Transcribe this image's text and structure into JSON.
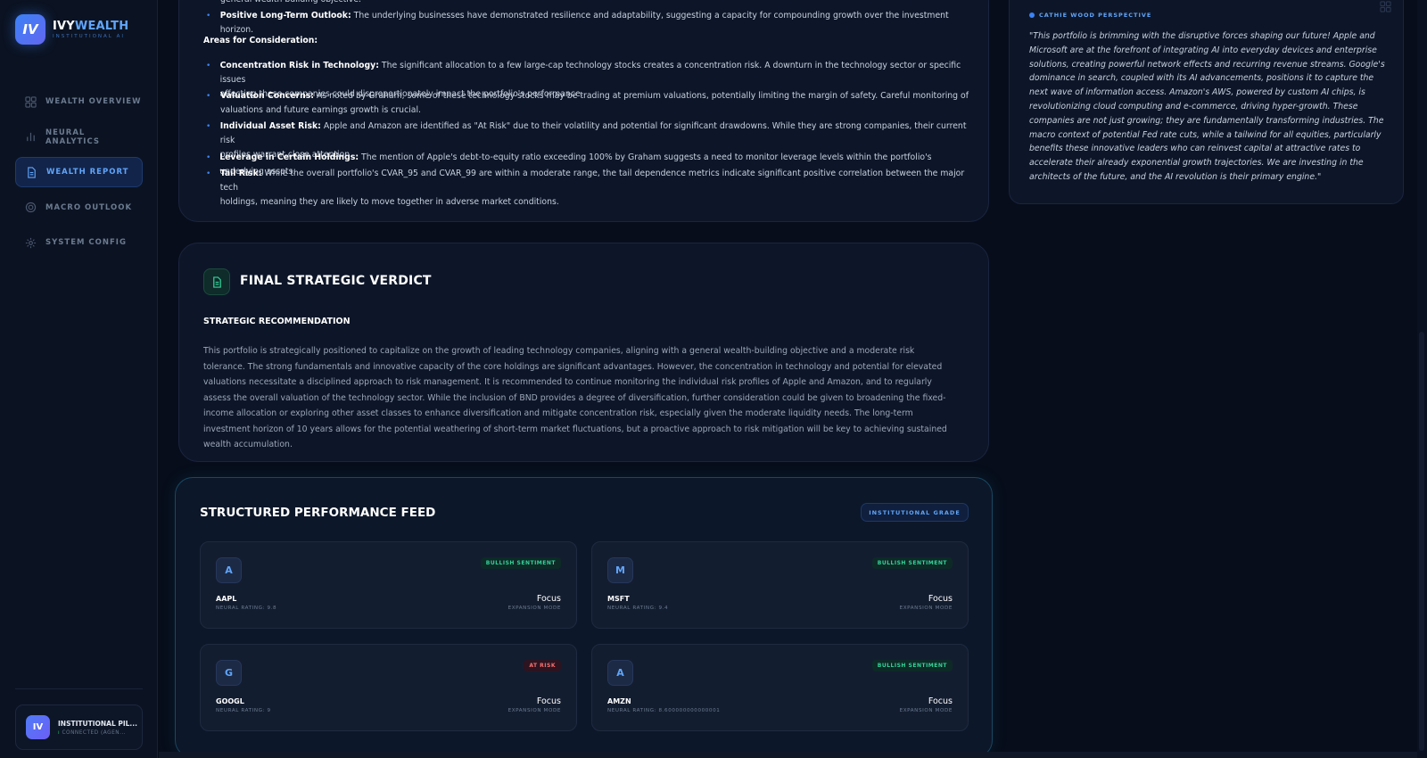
{
  "brand": {
    "logo": "IV",
    "name_part1": "IVY",
    "name_part2": "WEALTH",
    "subtitle": "INSTITUTIONAL AI"
  },
  "nav": [
    {
      "label": "WEALTH OVERVIEW",
      "icon": "grid-icon",
      "active": false
    },
    {
      "label": "NEURAL ANALYTICS",
      "icon": "bar-chart-icon",
      "active": false
    },
    {
      "label": "WEALTH REPORT",
      "icon": "document-icon",
      "active": true
    },
    {
      "label": "MACRO OUTLOOK",
      "icon": "globe-icon",
      "active": false
    },
    {
      "label": "SYSTEM CONFIG",
      "icon": "gear-icon",
      "active": false
    }
  ],
  "user": {
    "avatar": "IV",
    "name": "INSTITUTIONAL PIL...",
    "status": "CONNECTED (AGEN..."
  },
  "report": {
    "cut_line": "general wealth building objective.",
    "strengths_last": {
      "title": "Positive Long-Term Outlook:",
      "text": "The underlying businesses have demonstrated resilience and adaptability, suggesting a capacity for compounding growth over the investment horizon."
    },
    "areas_heading": "Areas for Consideration:",
    "areas": [
      {
        "title": "Concentration Risk in Technology:",
        "line1": "The significant allocation to a few large-cap technology stocks creates a concentration risk. A downturn in the technology sector or specific issues",
        "line2": "affecting these companies could disproportionately impact the portfolio's performance."
      },
      {
        "title": "Valuation Concerns:",
        "line1": "As noted by Graham, some of these technology stocks may be trading at premium valuations, potentially limiting the margin of safety. Careful monitoring of",
        "line2": "valuations and future earnings growth is crucial."
      },
      {
        "title": "Individual Asset Risk:",
        "line1": "Apple and Amazon are identified as \"At Risk\" due to their volatility and potential for significant drawdowns. While they are strong companies, their current risk",
        "line2": "profiles warrant close attention."
      },
      {
        "title": "Leverage in Certain Holdings:",
        "line1": "The mention of Apple's debt-to-equity ratio exceeding 100% by Graham suggests a need to monitor leverage levels within the portfolio's underlying assets.",
        "line2": ""
      },
      {
        "title": "Tail Risk:",
        "line1": "While the overall portfolio's CVAR_95 and CVAR_99 are within a moderate range, the tail dependence metrics indicate significant positive correlation between the major tech",
        "line2": "holdings, meaning they are likely to move together in adverse market conditions."
      }
    ]
  },
  "verdict": {
    "title": "FINAL STRATEGIC VERDICT",
    "subheading": "STRATEGIC RECOMMENDATION",
    "body": "This portfolio is strategically positioned to capitalize on the growth of leading technology companies, aligning with a general wealth-building objective and a moderate risk tolerance. The strong fundamentals and innovative capacity of the core holdings are significant advantages. However, the concentration in technology and potential for elevated valuations necessitate a disciplined approach to risk management. It is recommended to continue monitoring the individual risk profiles of Apple and Amazon, and to regularly assess the overall valuation of the technology sector. While the inclusion of BND provides a degree of diversification, further consideration could be given to broadening the fixed-income allocation or exploring other asset classes to enhance diversification and mitigate concentration risk, especially given the moderate liquidity needs. The long-term investment horizon of 10 years allows for the potential weathering of short-term market fluctuations, but a proactive approach to risk mitigation will be key to achieving sustained wealth accumulation."
  },
  "feed": {
    "title": "STRUCTURED PERFORMANCE FEED",
    "badge": "INSTITUTIONAL GRADE",
    "assets": [
      {
        "letter": "A",
        "ticker": "AAPL",
        "rating": "NEURAL RATING: 9.8",
        "sentiment": "BULLISH SENTIMENT",
        "sentiment_type": "bull",
        "focus": "Focus",
        "mode": "EXPANSION MODE"
      },
      {
        "letter": "M",
        "ticker": "MSFT",
        "rating": "NEURAL RATING: 9.4",
        "sentiment": "BULLISH SENTIMENT",
        "sentiment_type": "bull",
        "focus": "Focus",
        "mode": "EXPANSION MODE"
      },
      {
        "letter": "G",
        "ticker": "GOOGL",
        "rating": "NEURAL RATING: 9",
        "sentiment": "AT RISK",
        "sentiment_type": "risk",
        "focus": "Focus",
        "mode": "EXPANSION MODE"
      },
      {
        "letter": "A",
        "ticker": "AMZN",
        "rating": "NEURAL RATING: 8.600000000000001",
        "sentiment": "BULLISH SENTIMENT",
        "sentiment_type": "bull",
        "focus": "Focus",
        "mode": "EXPANSION MODE"
      }
    ]
  },
  "cathie": {
    "label": "CATHIE WOOD PERSPECTIVE",
    "quote": "\"This portfolio is brimming with the disruptive forces shaping our future! Apple and Microsoft are at the forefront of integrating AI into everyday devices and enterprise solutions, creating powerful network effects and recurring revenue streams. Google's dominance in search, coupled with its AI advancements, positions it to capture the next wave of information access. Amazon's AWS, powered by custom AI chips, is revolutionizing cloud computing and e-commerce, driving hyper-growth. These companies are not just growing; they are fundamentally transforming industries. The macro context of potential Fed rate cuts, while a tailwind for all equities, particularly benefits these innovative leaders who can reinvest capital at attractive rates to accelerate their already exponential growth trajectories. We are investing in the architects of the future, and the AI revolution is their primary engine.\""
  },
  "colors": {
    "background": "#070d1a",
    "accent": "#3b82f6",
    "bullish": "#34d399",
    "risk": "#f87171"
  }
}
